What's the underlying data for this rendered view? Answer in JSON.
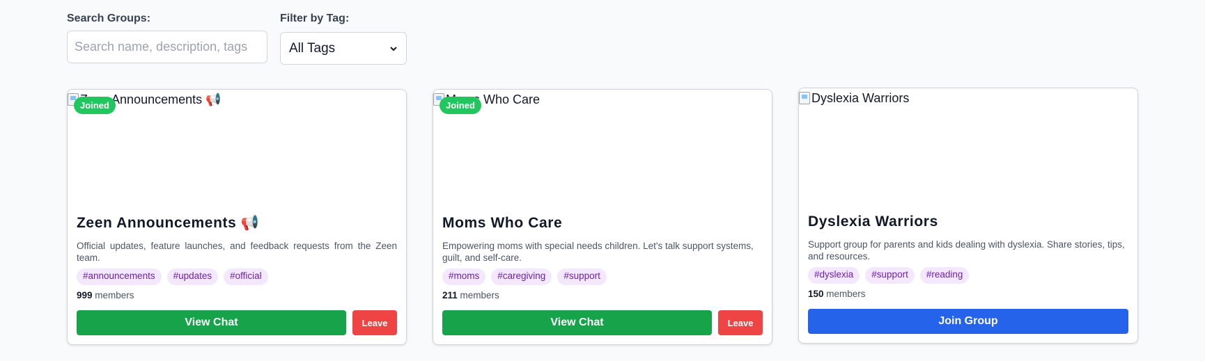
{
  "filters": {
    "search_label": "Search Groups:",
    "search_placeholder": "Search name, description, tags",
    "tag_label": "Filter by Tag:",
    "tag_selected": "All Tags"
  },
  "groups": [
    {
      "image_alt": "Zeen Announcements 📢",
      "joined_badge": "Joined",
      "title": "Zeen Announcements 📢",
      "description": "Official updates, feature launches, and feedback requests from the Zeen team.",
      "tags": [
        "#announcements",
        "#updates",
        "#official"
      ],
      "member_count": "999",
      "members_label": "members",
      "primary_action": "View Chat",
      "secondary_action": "Leave"
    },
    {
      "image_alt": "Moms Who Care",
      "joined_badge": "Joined",
      "title": "Moms Who Care",
      "description": "Empowering moms with special needs children. Let's talk support systems, guilt, and self-care.",
      "tags": [
        "#moms",
        "#caregiving",
        "#support"
      ],
      "member_count": "211",
      "members_label": "members",
      "primary_action": "View Chat",
      "secondary_action": "Leave"
    },
    {
      "image_alt": "Dyslexia Warriors",
      "title": "Dyslexia Warriors",
      "description": "Support group for parents and kids dealing with dyslexia. Share stories, tips, and resources.",
      "tags": [
        "#dyslexia",
        "#support",
        "#reading"
      ],
      "member_count": "150",
      "members_label": "members",
      "primary_action": "Join Group"
    }
  ],
  "colors": {
    "joined_badge": "#22c55e",
    "view_chat": "#16a34a",
    "leave": "#ef4444",
    "join": "#2563eb",
    "tag_bg": "#f3e8ff",
    "tag_text": "#6b21a8"
  },
  "icons": {
    "broken_image": "broken-image-icon",
    "select_chevron": "chevron-down-icon"
  }
}
